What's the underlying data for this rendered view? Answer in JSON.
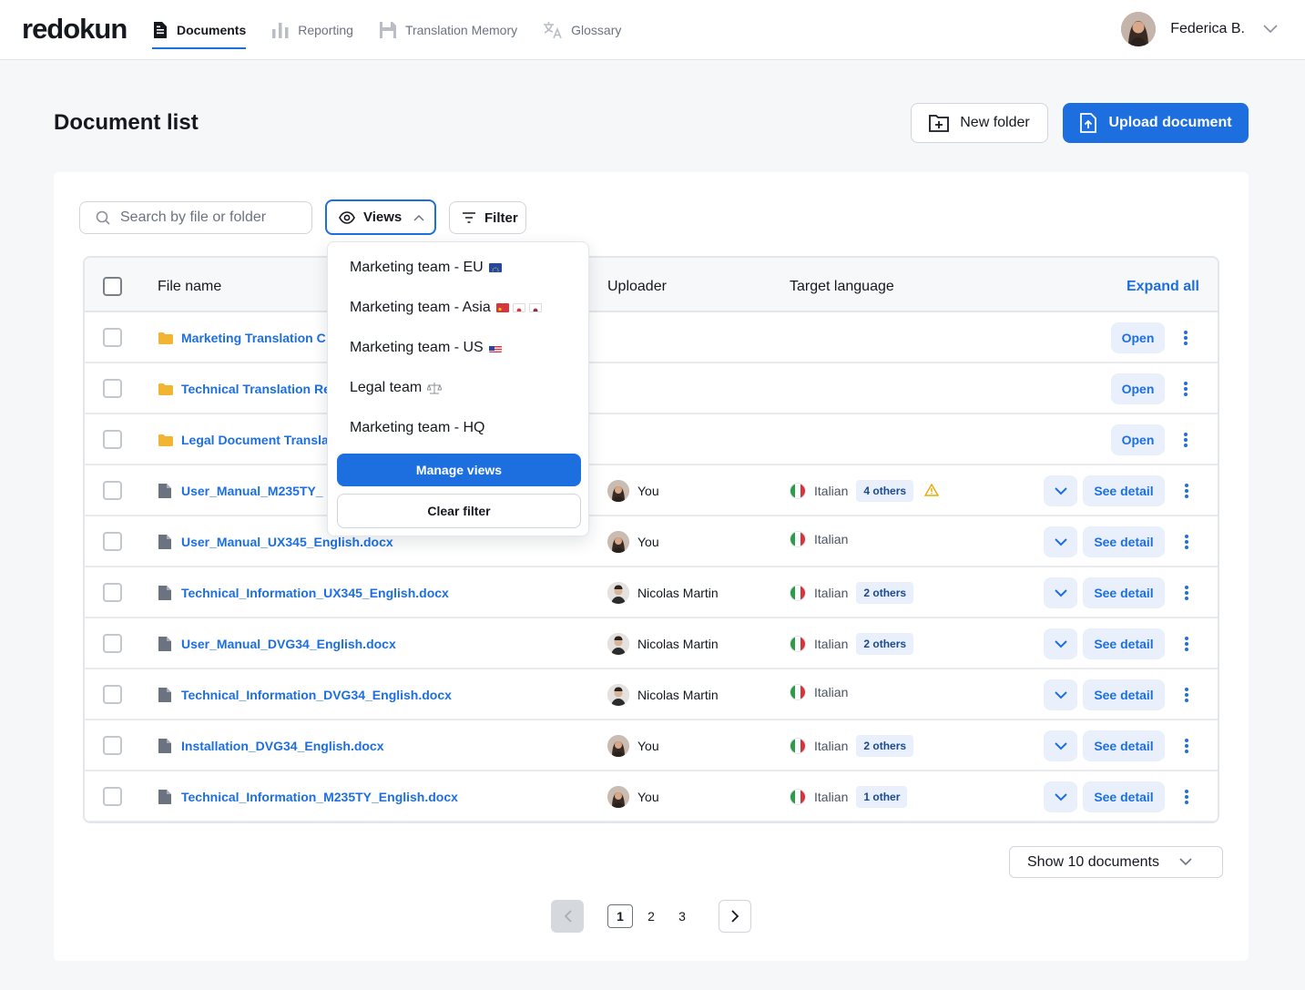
{
  "app": {
    "logo": "redokun"
  },
  "nav": {
    "items": [
      {
        "label": "Documents",
        "icon": "document-icon",
        "active": true
      },
      {
        "label": "Reporting",
        "icon": "bar-chart-icon",
        "active": false
      },
      {
        "label": "Translation Memory",
        "icon": "floppy-icon",
        "active": false
      },
      {
        "label": "Glossary",
        "icon": "translate-icon",
        "active": false
      }
    ]
  },
  "user": {
    "name": "Federica B."
  },
  "page": {
    "title": "Document list"
  },
  "actions": {
    "new_folder": "New folder",
    "upload": "Upload document"
  },
  "toolbar": {
    "search_placeholder": "Search by file or folder",
    "views_label": "Views",
    "filter_label": "Filter"
  },
  "table": {
    "columns": {
      "file_name": "File name",
      "uploader": "Uploader",
      "target_language": "Target language",
      "expand_all": "Expand all"
    },
    "open_label": "Open",
    "detail_label": "See detail",
    "rows": [
      {
        "type": "folder",
        "name": "Marketing Translation C"
      },
      {
        "type": "folder",
        "name": "Technical Translation Re"
      },
      {
        "type": "folder",
        "name": "Legal Document Transla"
      },
      {
        "type": "file",
        "name": "User_Manual_M235TY_",
        "uploader": "You",
        "language": "Italian",
        "badge": "4 others",
        "warning": true
      },
      {
        "type": "file",
        "name": "User_Manual_UX345_English.docx",
        "uploader": "You",
        "language": "Italian",
        "badge": ""
      },
      {
        "type": "file",
        "name": "Technical_Information_UX345_English.docx",
        "uploader": "Nicolas Martin",
        "language": "Italian",
        "badge": "2 others"
      },
      {
        "type": "file",
        "name": "User_Manual_DVG34_English.docx",
        "uploader": "Nicolas Martin",
        "language": "Italian",
        "badge": "2 others"
      },
      {
        "type": "file",
        "name": "Technical_Information_DVG34_English.docx",
        "uploader": "Nicolas Martin",
        "language": "Italian",
        "badge": ""
      },
      {
        "type": "file",
        "name": "Installation_DVG34_English.docx",
        "uploader": "You",
        "language": "Italian",
        "badge": "2 others"
      },
      {
        "type": "file",
        "name": "Technical_Information_M235TY_English.docx",
        "uploader": "You",
        "language": "Italian",
        "badge": "1 other"
      }
    ]
  },
  "views_dropdown": {
    "items": [
      {
        "label": "Marketing team - EU",
        "flags": [
          "eu"
        ]
      },
      {
        "label": "Marketing team - Asia",
        "flags": [
          "cn",
          "jp",
          "kr"
        ]
      },
      {
        "label": "Marketing team - US",
        "flags": [
          "us"
        ]
      },
      {
        "label": "Legal team",
        "flags": [
          "scales"
        ]
      },
      {
        "label": "Marketing team - HQ",
        "flags": []
      }
    ],
    "manage_label": "Manage views",
    "clear_label": "Clear filter"
  },
  "pagination": {
    "show_label": "Show 10 documents",
    "pages": [
      "1",
      "2",
      "3"
    ],
    "current": "1"
  },
  "colors": {
    "accent": "#1d6fe0",
    "badge_bg": "#e9f0fb",
    "folder": "#f2b531",
    "warning": "#f0a500"
  }
}
